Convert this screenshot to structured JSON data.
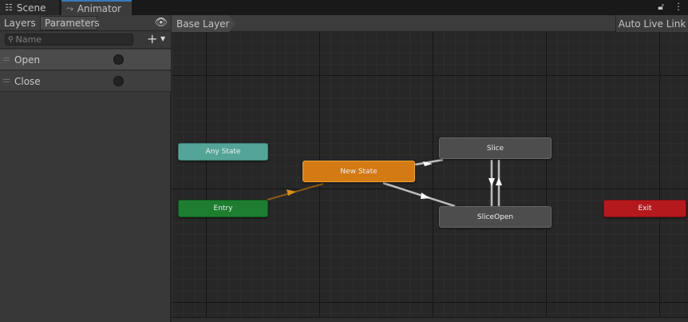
{
  "tabs": {
    "scene": {
      "label": "Scene",
      "icon": "grid-icon"
    },
    "animator": {
      "label": "Animator",
      "icon": "animator-icon"
    }
  },
  "window_controls": {
    "lock_icon": "lock-icon",
    "menu_icon": "kebab-menu-icon"
  },
  "left_panel": {
    "subtabs": {
      "layers": "Layers",
      "parameters": "Parameters"
    },
    "visibility_icon": "eye-icon",
    "search": {
      "placeholder": "Name",
      "value": ""
    },
    "parameters": [
      {
        "name": "Open",
        "type": "trigger",
        "selected": true
      },
      {
        "name": "Close",
        "type": "trigger",
        "selected": false
      }
    ]
  },
  "breadcrumb": {
    "layer": "Base Layer"
  },
  "toolbar": {
    "auto_live_link": "Auto Live Link"
  },
  "colors": {
    "any_state": "#54a597",
    "entry": "#1d7e30",
    "default_state": "#d47a14",
    "state": "#4d4d4d",
    "exit": "#b4191d",
    "accent": "#3a79bb"
  },
  "states": {
    "any_state": "Any State",
    "entry": "Entry",
    "new_state": "New State",
    "slice": "Slice",
    "slice_open": "SliceOpen",
    "exit": "Exit"
  }
}
